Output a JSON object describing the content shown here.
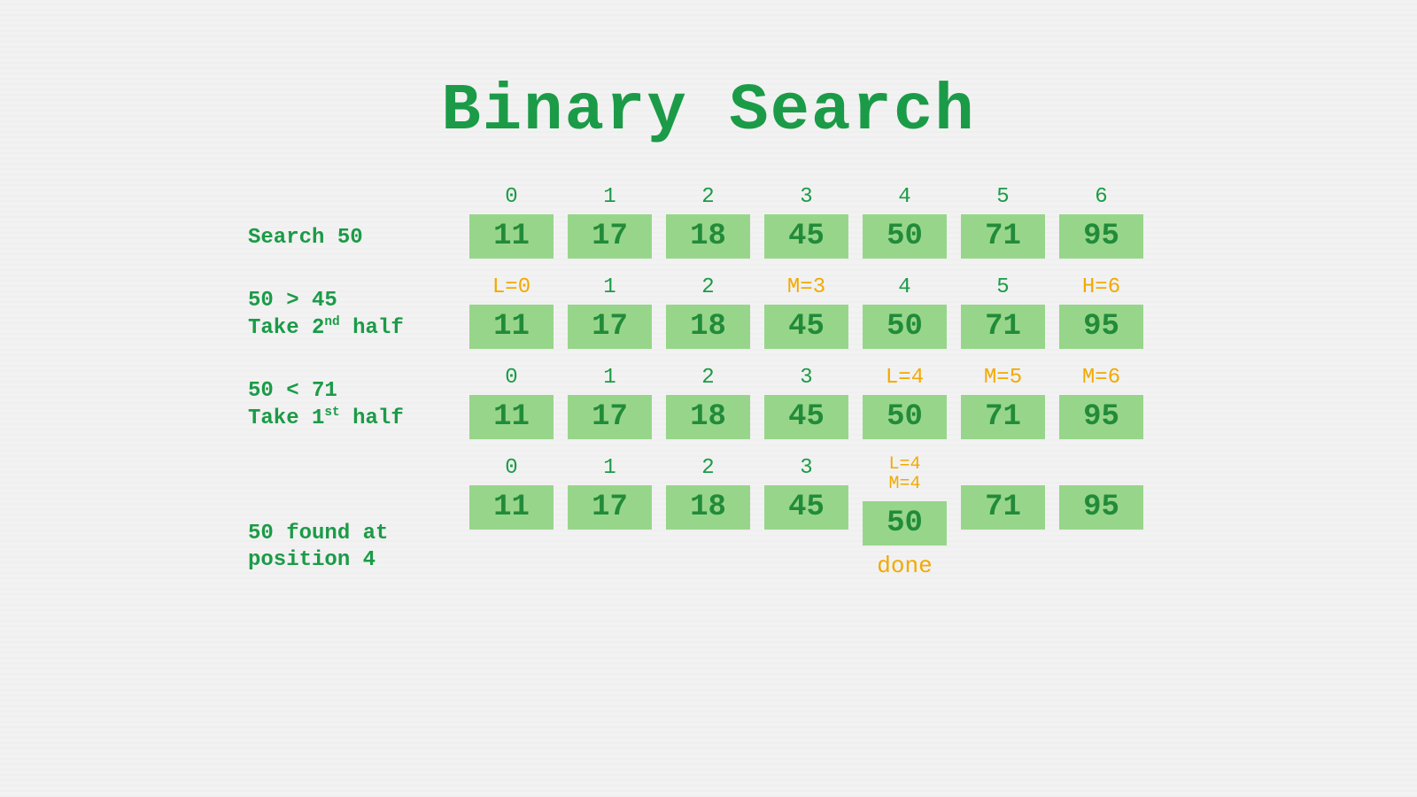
{
  "title": "Binary Search",
  "array": [
    11,
    17,
    18,
    45,
    50,
    71,
    95
  ],
  "steps": [
    {
      "desc_html": "Search 50",
      "indices": [
        {
          "text": "0",
          "hl": false
        },
        {
          "text": "1",
          "hl": false
        },
        {
          "text": "2",
          "hl": false
        },
        {
          "text": "3",
          "hl": false
        },
        {
          "text": "4",
          "hl": false
        },
        {
          "text": "5",
          "hl": false
        },
        {
          "text": "6",
          "hl": false
        }
      ],
      "footer": [
        "",
        "",
        "",
        "",
        "",
        "",
        ""
      ]
    },
    {
      "desc_html": "50 > 45<br>Take 2<sup>nd</sup> half",
      "indices": [
        {
          "text": "L=0",
          "hl": true
        },
        {
          "text": "1",
          "hl": false
        },
        {
          "text": "2",
          "hl": false
        },
        {
          "text": "M=3",
          "hl": true
        },
        {
          "text": "4",
          "hl": false
        },
        {
          "text": "5",
          "hl": false
        },
        {
          "text": "H=6",
          "hl": true
        }
      ],
      "footer": [
        "",
        "",
        "",
        "",
        "",
        "",
        ""
      ]
    },
    {
      "desc_html": "50 < 71<br>Take 1<sup>st</sup> half",
      "indices": [
        {
          "text": "0",
          "hl": false
        },
        {
          "text": "1",
          "hl": false
        },
        {
          "text": "2",
          "hl": false
        },
        {
          "text": "3",
          "hl": false
        },
        {
          "text": "L=4",
          "hl": true
        },
        {
          "text": "M=5",
          "hl": true
        },
        {
          "text": "M=6",
          "hl": true
        }
      ],
      "footer": [
        "",
        "",
        "",
        "",
        "",
        "",
        ""
      ]
    },
    {
      "desc_html": "50 found at<br>position 4",
      "indices": [
        {
          "text": "0",
          "hl": false
        },
        {
          "text": "1",
          "hl": false
        },
        {
          "text": "2",
          "hl": false
        },
        {
          "text": "3",
          "hl": false
        },
        {
          "text": "L=4\nM=4",
          "hl": true,
          "multi": true
        },
        {
          "text": "",
          "hl": false
        },
        {
          "text": "",
          "hl": false
        }
      ],
      "footer": [
        "",
        "",
        "",
        "",
        "done",
        "",
        ""
      ]
    }
  ]
}
